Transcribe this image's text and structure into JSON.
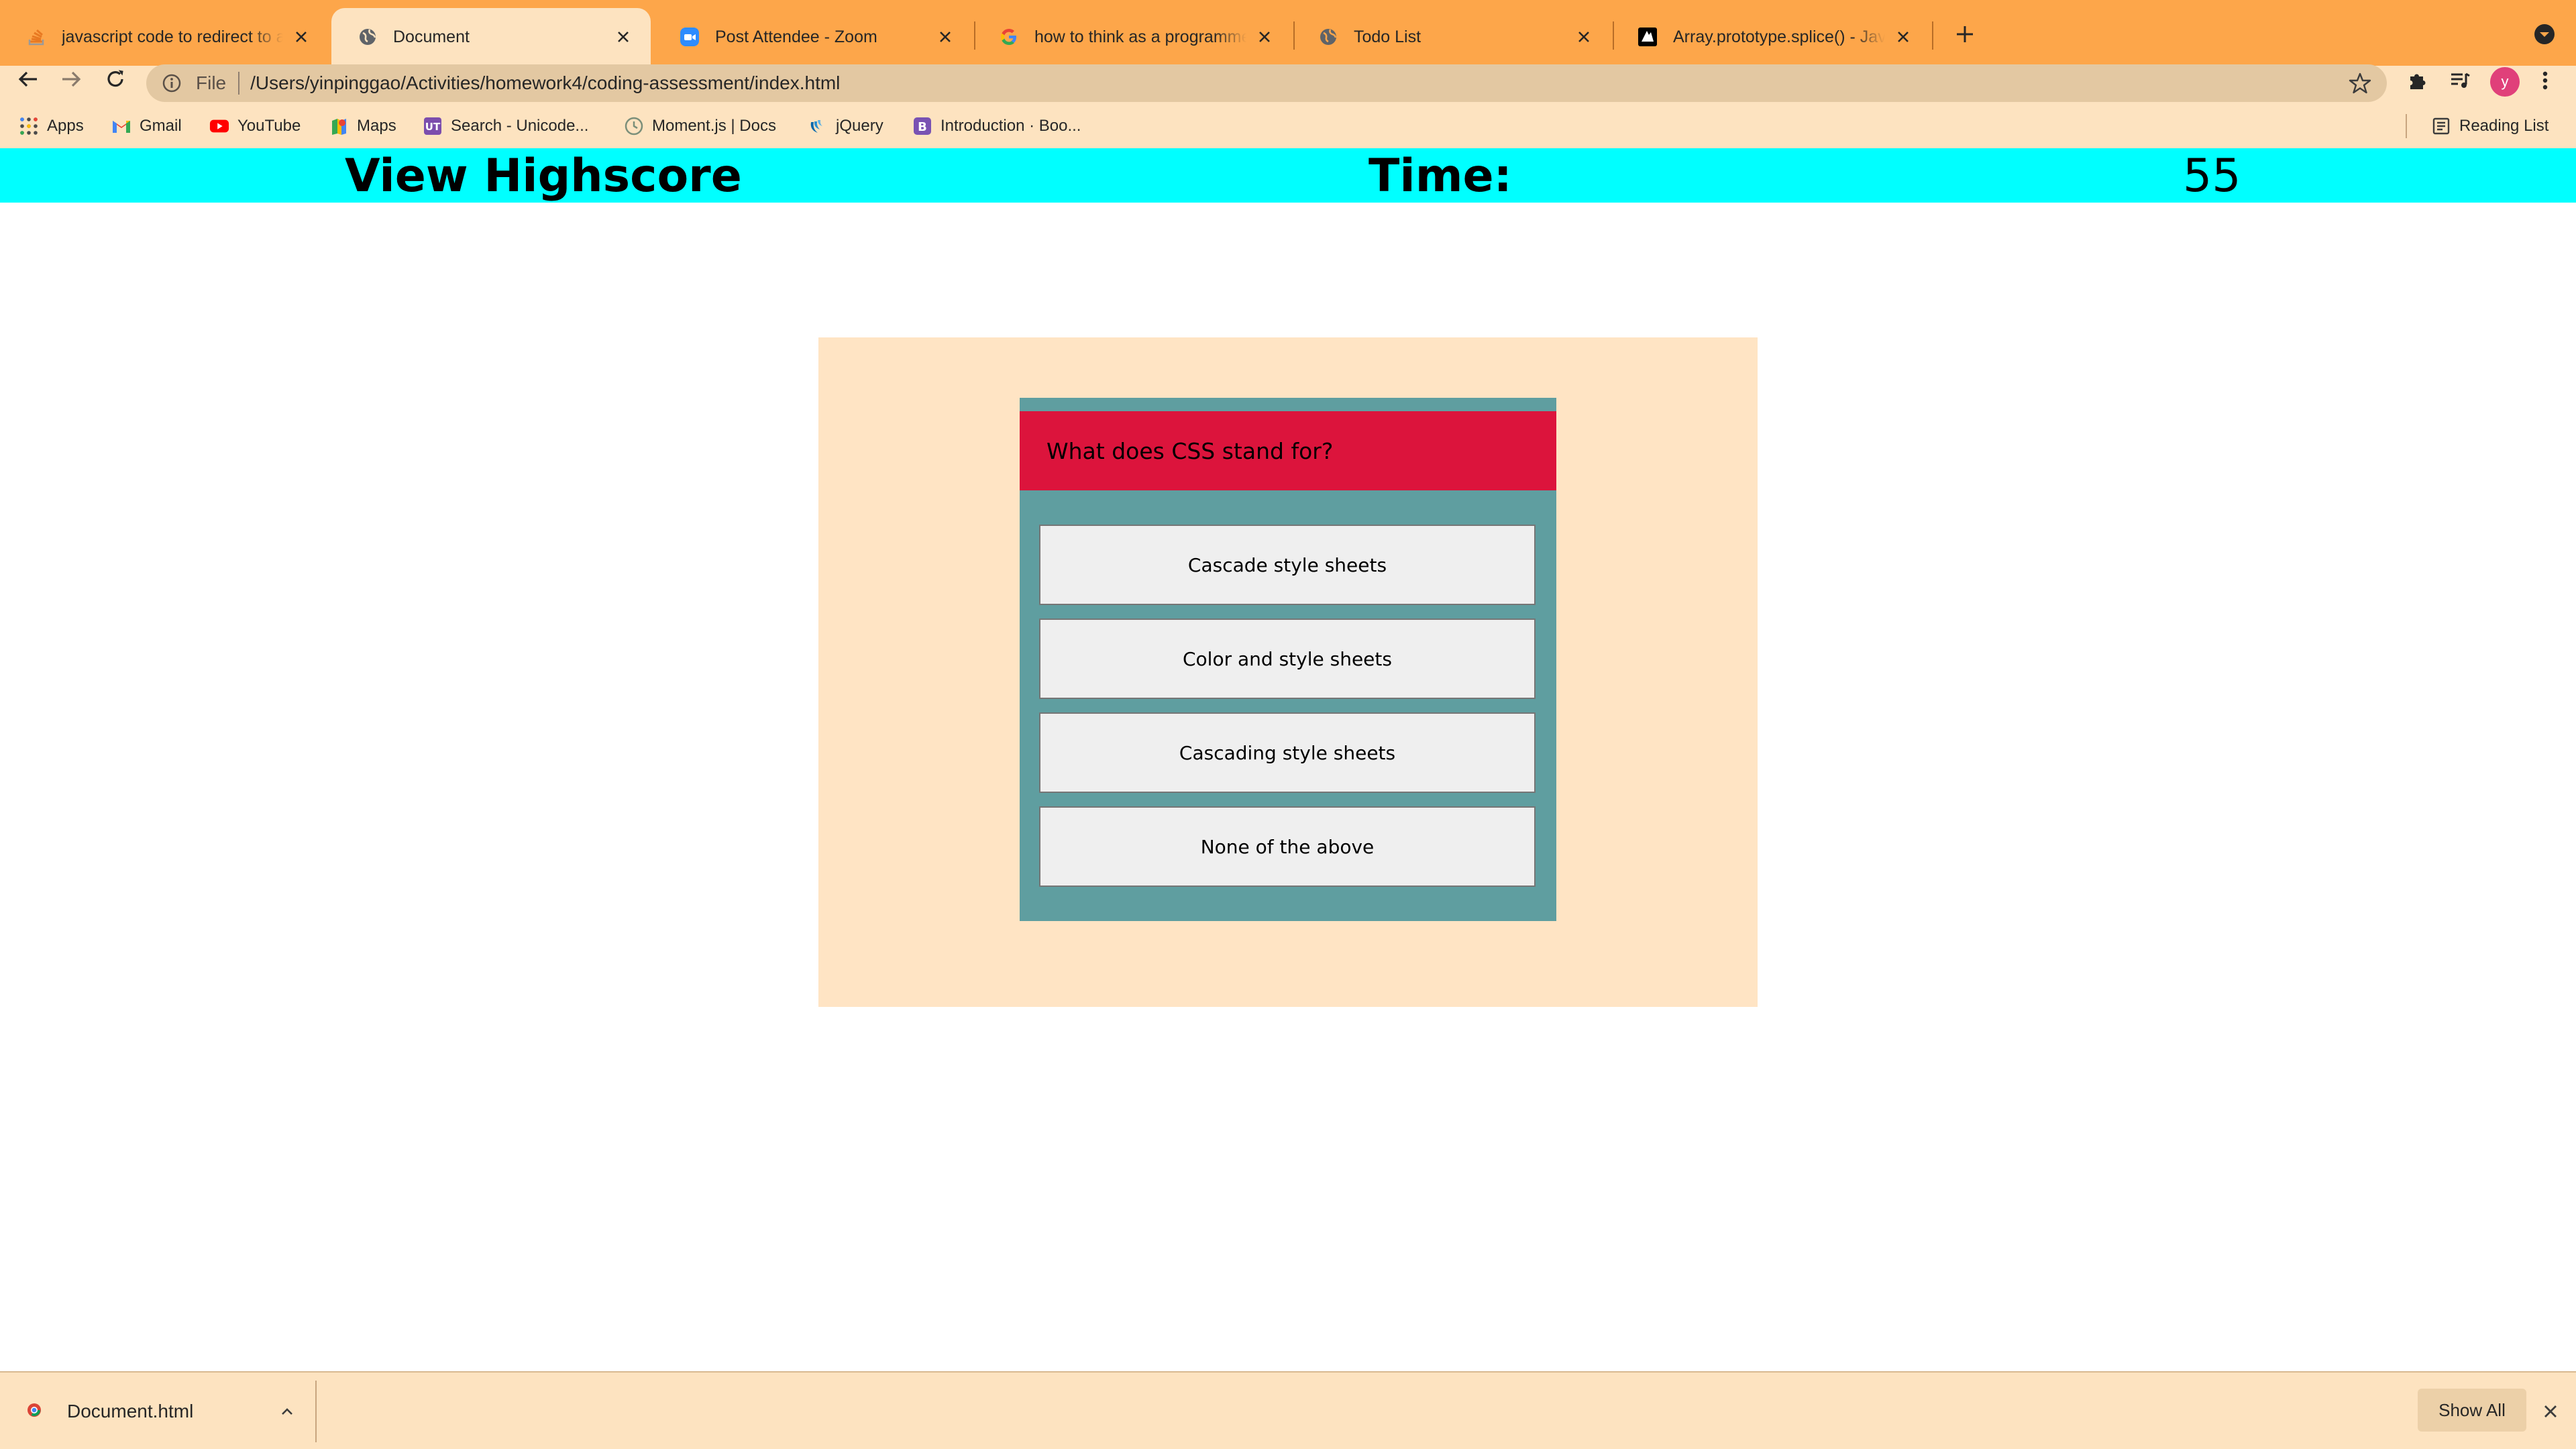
{
  "browser": {
    "tabs": [
      {
        "title": "javascript code to redirect to a",
        "icon": "stackoverflow-icon",
        "active": false
      },
      {
        "title": "Document",
        "icon": "globe-icon",
        "active": true
      },
      {
        "title": "Post Attendee - Zoom",
        "icon": "zoom-icon",
        "active": false
      },
      {
        "title": "how to think as a programmer",
        "icon": "google-icon",
        "active": false
      },
      {
        "title": "Todo List",
        "icon": "globe-icon",
        "active": false
      },
      {
        "title": "Array.prototype.splice() - Java",
        "icon": "mdn-icon",
        "active": false
      }
    ],
    "address": {
      "scheme_label": "File",
      "url": "/Users/yinpinggao/Activities/homework4/coding-assessment/index.html"
    },
    "profile_initial": "y",
    "bookmarks": [
      {
        "label": "Apps",
        "icon": "apps-grid-icon"
      },
      {
        "label": "Gmail",
        "icon": "gmail-icon"
      },
      {
        "label": "YouTube",
        "icon": "youtube-icon"
      },
      {
        "label": "Maps",
        "icon": "maps-icon"
      },
      {
        "label": "Search - Unicode...",
        "icon": "unicode-icon"
      },
      {
        "label": "Moment.js | Docs",
        "icon": "moment-icon"
      },
      {
        "label": "jQuery",
        "icon": "jquery-icon"
      },
      {
        "label": "Introduction · Boo...",
        "icon": "bootstrap-icon"
      }
    ],
    "reading_list_label": "Reading List"
  },
  "header": {
    "highscore_label": "View Highscore",
    "time_label": "Time:",
    "time_value": "55"
  },
  "quiz": {
    "question": "What does CSS stand for?",
    "answers": [
      "Cascade style sheets",
      "Color and style sheets",
      "Cascading style sheets",
      "None of the above"
    ]
  },
  "download_shelf": {
    "filename": "Document.html",
    "show_all_label": "Show All"
  },
  "colors": {
    "tab_strip": "#fda64a",
    "toolbar": "#fde3c0",
    "header_bar": "#00ffff",
    "quiz_outer": "#ffe4c4",
    "quiz_card": "#5f9ea0",
    "question_bar": "#dc143c",
    "answer_button": "#efefef"
  }
}
